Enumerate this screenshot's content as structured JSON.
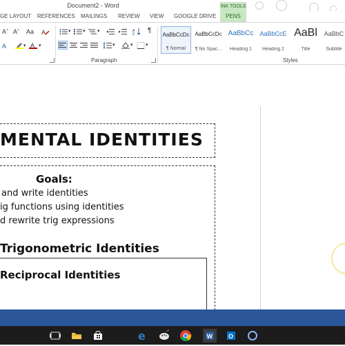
{
  "window": {
    "title": "Document2 - Word"
  },
  "contextual": {
    "group": "INK TOOLS",
    "tab": "PENS"
  },
  "tabs": [
    "GE LAYOUT",
    "REFERENCES",
    "MAILINGS",
    "REVIEW",
    "VIEW",
    "GOOGLE DRIVE"
  ],
  "ribbon": {
    "font_row1": [
      "Aˆ",
      "Aˇ",
      "Aa"
    ],
    "pilcrow": "¶",
    "paragraph_label": "Paragraph",
    "styles_label": "Styles",
    "styles": [
      {
        "sample": "AaBbCcDc",
        "name": "¶ Normal"
      },
      {
        "sample": "AaBbCcDc",
        "name": "¶ No Spac..."
      },
      {
        "sample": "AaBbCc",
        "name": "Heading 1"
      },
      {
        "sample": "AaBbCcE",
        "name": "Heading 2"
      },
      {
        "sample": "AaBl",
        "name": "Title"
      },
      {
        "sample": "AaBbC",
        "name": "Subtitle"
      }
    ],
    "colors": {
      "highlight": "#ffff00",
      "font": "#c00000",
      "active_style": "#8fb0d8",
      "accent": "#2b579a",
      "pens_tab": "#c9e6c2"
    }
  },
  "document": {
    "banner": "MENTAL IDENTITIES",
    "goals_heading": "Goals:",
    "goals": [
      "and write identities",
      "ig functions using identities",
      "d rewrite trig expressions"
    ],
    "section_heading": "Trigonometric Identities",
    "subsection_heading": "Reciprocal Identities"
  },
  "taskbar": {
    "icons": [
      "task-view-icon",
      "file-explorer-icon",
      "store-icon",
      "edge-icon",
      "paint-icon",
      "chrome-icon",
      "word-icon",
      "outlook-icon",
      "cortana-icon"
    ]
  }
}
